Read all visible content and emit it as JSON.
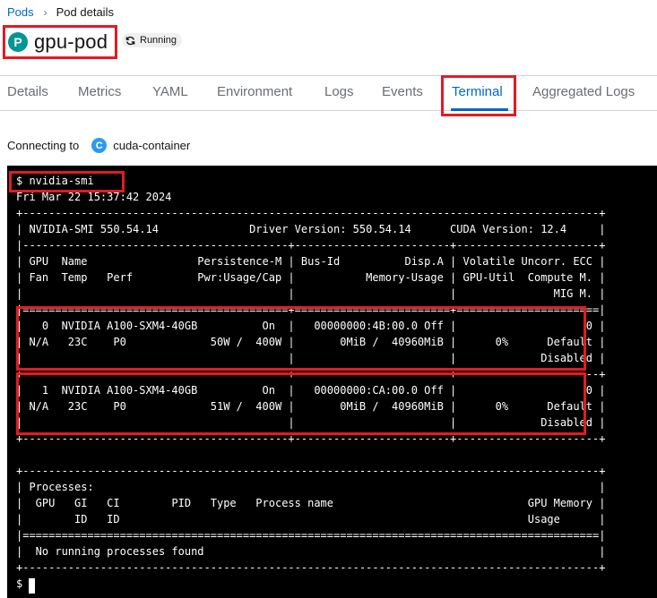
{
  "breadcrumb": {
    "parent": "Pods",
    "current": "Pod details"
  },
  "resource": {
    "badge": "P",
    "name": "gpu-pod",
    "status": "Running"
  },
  "tabs": [
    {
      "label": "Details"
    },
    {
      "label": "Metrics"
    },
    {
      "label": "YAML"
    },
    {
      "label": "Environment"
    },
    {
      "label": "Logs"
    },
    {
      "label": "Events"
    },
    {
      "label": "Terminal"
    },
    {
      "label": "Aggregated Logs"
    }
  ],
  "active_tab": "Terminal",
  "connecting": {
    "label": "Connecting to",
    "badge": "C",
    "container": "cuda-container"
  },
  "terminal": {
    "command_line": "$ nvidia-smi",
    "output": "Fri Mar 22 15:37:42 2024\n+-----------------------------------------------------------------------------------------+\n| NVIDIA-SMI 550.54.14              Driver Version: 550.54.14      CUDA Version: 12.4     |\n|-----------------------------------------+------------------------+----------------------+\n| GPU  Name                 Persistence-M | Bus-Id          Disp.A | Volatile Uncorr. ECC |\n| Fan  Temp   Perf          Pwr:Usage/Cap |           Memory-Usage | GPU-Util  Compute M. |\n|                                         |                        |               MIG M. |\n|=========================================+========================+======================|\n|   0  NVIDIA A100-SXM4-40GB          On  |   00000000:4B:00.0 Off |                    0 |\n| N/A   23C    P0             50W /  400W |       0MiB /  40960MiB |      0%      Default |\n|                                         |                        |             Disabled |\n+-----------------------------------------+------------------------+----------------------+\n|   1  NVIDIA A100-SXM4-40GB          On  |   00000000:CA:00.0 Off |                    0 |\n| N/A   23C    P0             51W /  400W |       0MiB /  40960MiB |      0%      Default |\n|                                         |                        |             Disabled |\n+-----------------------------------------+------------------------+----------------------+\n\n+-----------------------------------------------------------------------------------------+\n| Processes:                                                                              |\n|  GPU   GI   CI        PID   Type   Process name                              GPU Memory |\n|        ID   ID                                                               Usage      |\n|=========================================================================================|\n|  No running processes found                                                             |\n+-----------------------------------------------------------------------------------------+",
    "prompt": "$"
  }
}
